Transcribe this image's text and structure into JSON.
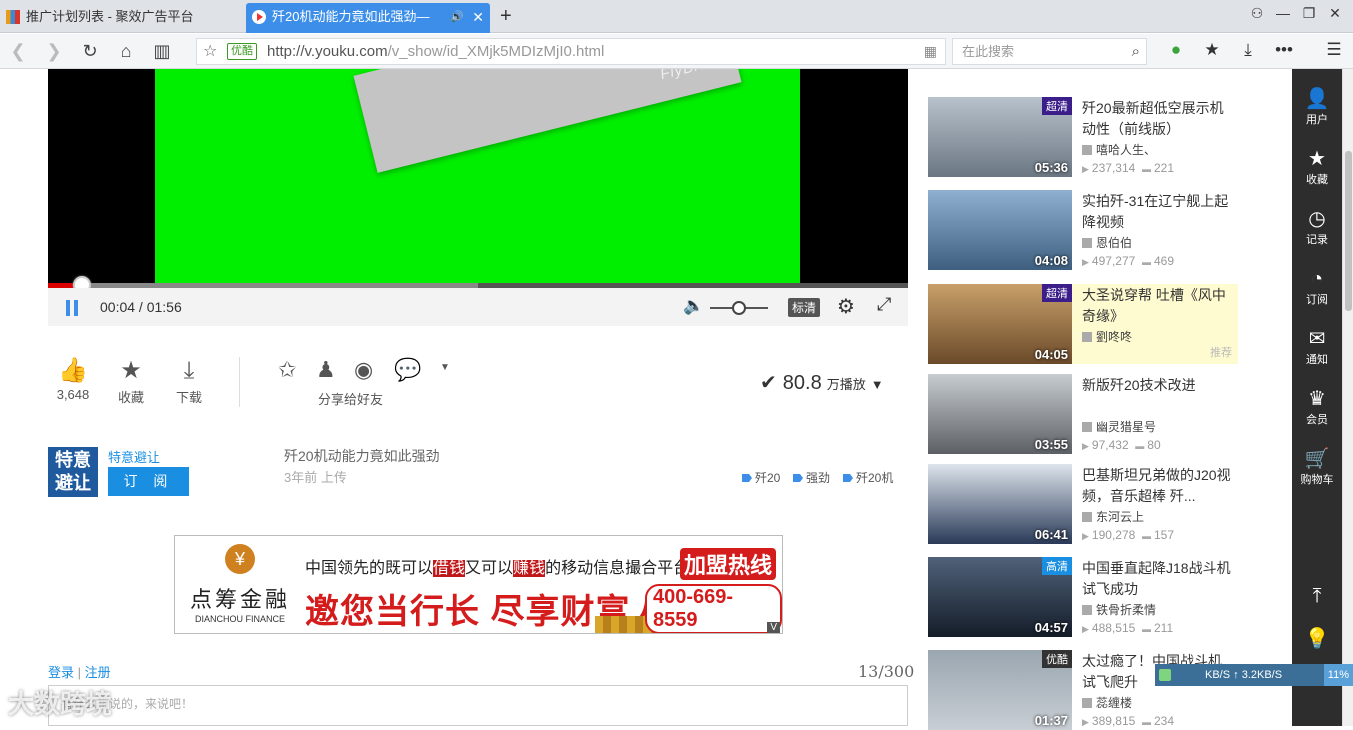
{
  "browser": {
    "tabs": [
      {
        "title": "推广计划列表 - 聚效广告平台"
      },
      {
        "title": "歼20机动能力竟如此强劲—"
      }
    ],
    "new_tab": "+",
    "url_badge": "优酷",
    "url_host": "http://v.youku.com",
    "url_path": "/v_show/id_XMjk5MDIzMjI0.html",
    "search_placeholder": "在此搜索"
  },
  "player": {
    "logo_text": "FlyBNB",
    "time": "00:04 / 01:56",
    "progress_fraction": 0.04,
    "buffer_fraction": 0.5,
    "volume_fraction": 0.5,
    "quality": "标清"
  },
  "actions": {
    "like_count": "3,648",
    "collect": "收藏",
    "download": "下载",
    "share_label": "分享给好友",
    "play_count_value": "80.8",
    "play_count_unit": "万播放"
  },
  "channel": {
    "logo_text": "特意避让",
    "name": "特意避让",
    "subscribe": "订 阅",
    "video_title": "歼20机动能力竟如此强劲",
    "upload_time": "3年前 上传",
    "tags": [
      "歼20",
      "强劲",
      "歼20机"
    ]
  },
  "ad": {
    "brand_cn": "点筹金融",
    "brand_en": "DIANCHOU FINANCE",
    "headline_a": "中国领先的既可以",
    "headline_b": "借钱",
    "headline_c": "又可以",
    "headline_d": "赚钱",
    "headline_e": "的移动信息撮合平台",
    "slogan": "邀您当行长 尽享财富人生",
    "hotline": "加盟热线",
    "phone": "400-669-8559",
    "corner": "V"
  },
  "comments": {
    "login": "登录",
    "sep": "|",
    "register": "注册",
    "counter": "13/300",
    "placeholder": "有什么想说的，来说吧！"
  },
  "watermark": "大数跨境",
  "related": [
    {
      "title": "歼20最新超低空展示机动性（前线版）",
      "author": "嘻哈人生、",
      "plays": "237,314",
      "comments": "221",
      "duration": "05:36",
      "badge": "超清",
      "colors": [
        "#b8c2cc",
        "#6a7682"
      ]
    },
    {
      "title": "实拍歼-31在辽宁舰上起降视频",
      "author": "恩伯伯",
      "plays": "497,277",
      "comments": "469",
      "duration": "04:08",
      "badge": "",
      "colors": [
        "#8fb0d0",
        "#3e5f80"
      ]
    },
    {
      "title": "大圣说穿帮 吐槽《风中奇缘》",
      "author": "劉咚咚",
      "plays": "",
      "comments": "",
      "duration": "04:05",
      "badge": "超清",
      "recommend": "推荐",
      "colors": [
        "#c9a06a",
        "#6b4a2a"
      ]
    },
    {
      "title": "新版歼20技术改进",
      "author": "幽灵猎星号",
      "plays": "97,432",
      "comments": "80",
      "duration": "03:55",
      "badge": "",
      "colors": [
        "#c7ccd0",
        "#5c6064"
      ]
    },
    {
      "title": "巴基斯坦兄弟做的J20视频，音乐超棒 歼...",
      "author": "东河云上",
      "plays": "190,278",
      "comments": "157",
      "duration": "06:41",
      "badge": "",
      "colors": [
        "#dde4ec",
        "#2a3a58"
      ]
    },
    {
      "title": "中国垂直起降J18战斗机试飞成功",
      "author": "铁骨折柔情",
      "plays": "488,515",
      "comments": "211",
      "duration": "04:57",
      "badge": "高清",
      "badge_style": "hq",
      "colors": [
        "#50627a",
        "#141c28"
      ]
    },
    {
      "title": "太过瘾了！中国战斗机试飞爬升",
      "author": "蕊缠楼",
      "plays": "389,815",
      "comments": "234",
      "duration": "01:37",
      "badge": "优酷",
      "badge_style": "you",
      "colors": [
        "#9aa6b0",
        "#c8ced4"
      ]
    }
  ],
  "sidebar": [
    {
      "icon": "user-icon",
      "label": "用户"
    },
    {
      "icon": "star-icon",
      "label": "收藏"
    },
    {
      "icon": "history-icon",
      "label": "记录"
    },
    {
      "icon": "rss-icon",
      "label": "订阅"
    },
    {
      "icon": "mail-icon",
      "label": "通知"
    },
    {
      "icon": "crown-icon",
      "label": "会员"
    },
    {
      "icon": "cart-icon",
      "label": "购物车"
    }
  ],
  "netmeter": {
    "down": "KB/S",
    "up": "3.2KB/S",
    "percent": "11%"
  }
}
